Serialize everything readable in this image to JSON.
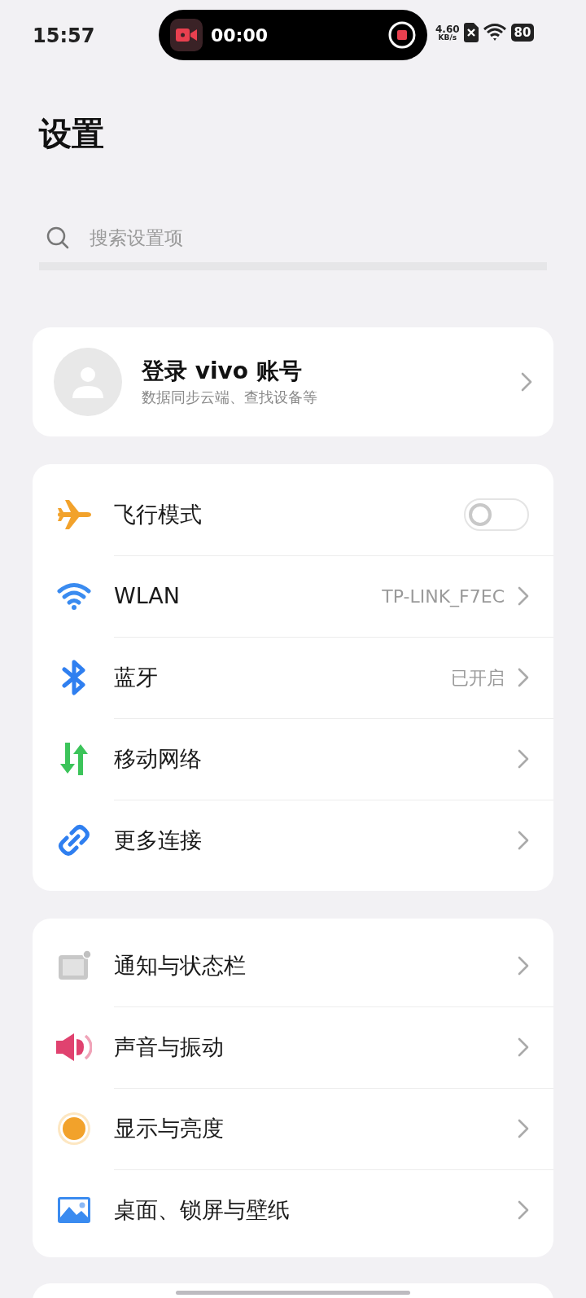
{
  "status_bar": {
    "time": "15:57",
    "recording": {
      "timer": "00:00"
    },
    "net_speed": "4.60",
    "net_unit": "KB/s",
    "battery": "80"
  },
  "title": "设置",
  "search": {
    "placeholder": "搜索设置项"
  },
  "account": {
    "title": "登录 vivo 账号",
    "subtitle": "数据同步云端、查找设备等"
  },
  "groups": [
    {
      "items": [
        {
          "kind": "toggle",
          "label": "飞行模式",
          "on": false
        },
        {
          "kind": "link",
          "label": "WLAN",
          "value": "TP-LINK_F7EC"
        },
        {
          "kind": "link",
          "label": "蓝牙",
          "value": "已开启"
        },
        {
          "kind": "link",
          "label": "移动网络"
        },
        {
          "kind": "link",
          "label": "更多连接"
        }
      ]
    },
    {
      "items": [
        {
          "kind": "link",
          "label": "通知与状态栏"
        },
        {
          "kind": "link",
          "label": "声音与振动"
        },
        {
          "kind": "link",
          "label": "显示与亮度"
        },
        {
          "kind": "link",
          "label": "桌面、锁屏与壁纸"
        }
      ]
    }
  ]
}
